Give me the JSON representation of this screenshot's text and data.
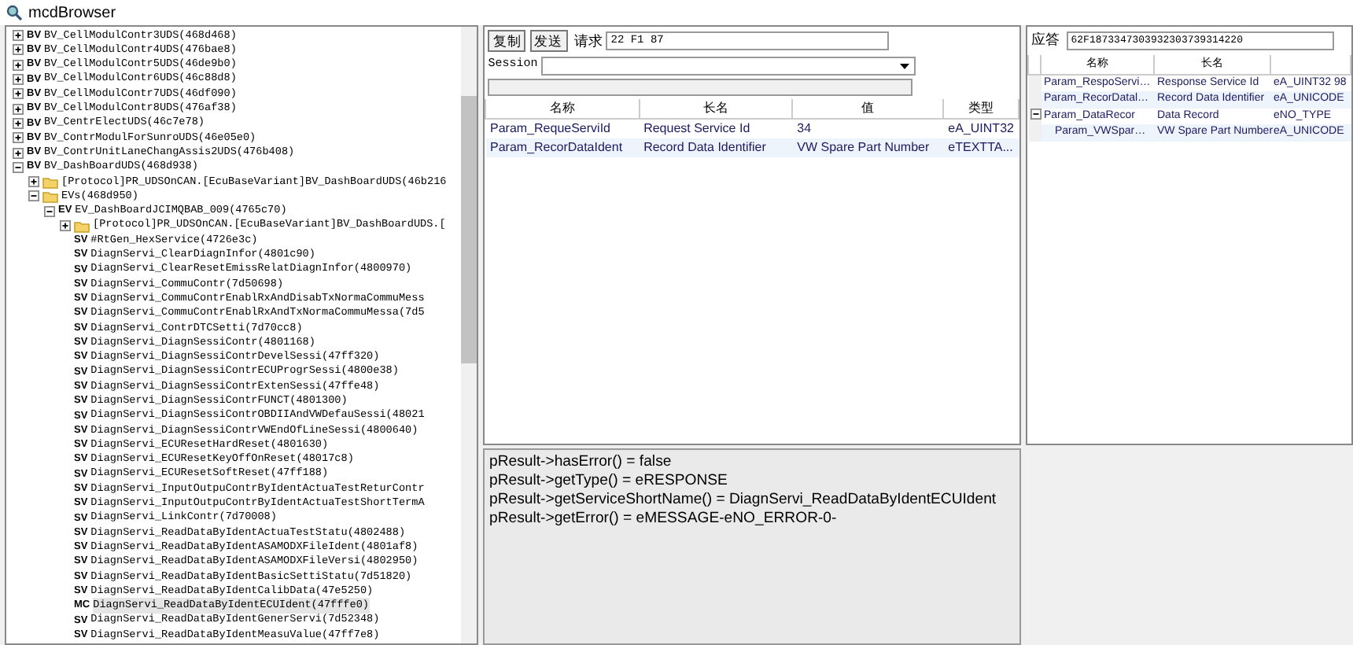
{
  "window": {
    "title": "mcdBrowser"
  },
  "tree": [
    {
      "badge": "BV",
      "label": "BV_CellModulContr3UDS(468d468)",
      "expanded": false,
      "selected": false
    },
    {
      "badge": "BV",
      "label": "BV_CellModulContr4UDS(476bae8)",
      "expanded": false,
      "selected": false
    },
    {
      "badge": "BV",
      "label": "BV_CellModulContr5UDS(46de9b0)",
      "expanded": false,
      "selected": false
    },
    {
      "badge": "BV",
      "label": "BV_CellModulContr6UDS(46c88d8)",
      "expanded": false,
      "selected": false
    },
    {
      "badge": "BV",
      "label": "BV_CellModulContr7UDS(46df090)",
      "expanded": false,
      "selected": false
    },
    {
      "badge": "BV",
      "label": "BV_CellModulContr8UDS(476af38)",
      "expanded": false,
      "selected": false
    },
    {
      "badge": "BV",
      "label": "BV_CentrElectUDS(46c7e78)",
      "expanded": false,
      "selected": false
    },
    {
      "badge": "BV",
      "label": "BV_ContrModulForSunroUDS(46e05e0)",
      "expanded": false,
      "selected": false
    },
    {
      "badge": "BV",
      "label": "BV_ContrUnitLaneChangAssis2UDS(476b408)",
      "expanded": false,
      "selected": false
    },
    {
      "badge": "BV",
      "label": "BV_DashBoardUDS(468d938)",
      "expanded": true,
      "selected": false,
      "children": [
        {
          "kind": "folder",
          "label": "[Protocol]PR_UDSOnCAN.[EcuBaseVariant]BV_DashBoardUDS(46b216",
          "expanded": false,
          "selected": false
        },
        {
          "kind": "folder",
          "label": "EVs(468d950)",
          "expanded": true,
          "selected": false,
          "children": [
            {
              "badge": "EV",
              "label": "EV_DashBoardJCIMQBAB_009(4765c70)",
              "expanded": true,
              "selected": false,
              "children": [
                {
                  "kind": "folder",
                  "label": "[Protocol]PR_UDSOnCAN.[EcuBaseVariant]BV_DashBoardUDS.[",
                  "expanded": false,
                  "selected": false
                },
                {
                  "badge": "SV",
                  "label": "#RtGen_HexService(4726e3c)",
                  "selected": false
                },
                {
                  "badge": "SV",
                  "label": "DiagnServi_ClearDiagnInfor(4801c90)",
                  "selected": false
                },
                {
                  "badge": "SV",
                  "label": "DiagnServi_ClearResetEmissRelatDiagnInfor(4800970)",
                  "selected": false
                },
                {
                  "badge": "SV",
                  "label": "DiagnServi_CommuContr(7d50698)",
                  "selected": false
                },
                {
                  "badge": "SV",
                  "label": "DiagnServi_CommuContrEnablRxAndDisabTxNormaCommuMess",
                  "selected": false
                },
                {
                  "badge": "SV",
                  "label": "DiagnServi_CommuContrEnablRxAndTxNormaCommuMessa(7d5",
                  "selected": false
                },
                {
                  "badge": "SV",
                  "label": "DiagnServi_ContrDTCSetti(7d70cc8)",
                  "selected": false
                },
                {
                  "badge": "SV",
                  "label": "DiagnServi_DiagnSessiContr(4801168)",
                  "selected": false
                },
                {
                  "badge": "SV",
                  "label": "DiagnServi_DiagnSessiContrDevelSessi(47ff320)",
                  "selected": false
                },
                {
                  "badge": "SV",
                  "label": "DiagnServi_DiagnSessiContrECUProgrSessi(4800e38)",
                  "selected": false
                },
                {
                  "badge": "SV",
                  "label": "DiagnServi_DiagnSessiContrExtenSessi(47ffe48)",
                  "selected": false
                },
                {
                  "badge": "SV",
                  "label": "DiagnServi_DiagnSessiContrFUNCT(4801300)",
                  "selected": false
                },
                {
                  "badge": "SV",
                  "label": "DiagnServi_DiagnSessiContrOBDIIAndVWDefauSessi(48021",
                  "selected": false
                },
                {
                  "badge": "SV",
                  "label": "DiagnServi_DiagnSessiContrVWEndOfLineSessi(4800640)",
                  "selected": false
                },
                {
                  "badge": "SV",
                  "label": "DiagnServi_ECUResetHardReset(4801630)",
                  "selected": false
                },
                {
                  "badge": "SV",
                  "label": "DiagnServi_ECUResetKeyOffOnReset(48017c8)",
                  "selected": false
                },
                {
                  "badge": "SV",
                  "label": "DiagnServi_ECUResetSoftReset(47ff188)",
                  "selected": false
                },
                {
                  "badge": "SV",
                  "label": "DiagnServi_InputOutpuContrByIdentActuaTestReturContr",
                  "selected": false
                },
                {
                  "badge": "SV",
                  "label": "DiagnServi_InputOutpuContrByIdentActuaTestShortTermA",
                  "selected": false
                },
                {
                  "badge": "SV",
                  "label": "DiagnServi_LinkContr(7d70008)",
                  "selected": false
                },
                {
                  "badge": "SV",
                  "label": "DiagnServi_ReadDataByIdentActuaTestStatu(4802488)",
                  "selected": false
                },
                {
                  "badge": "SV",
                  "label": "DiagnServi_ReadDataByIdentASAMODXFileIdent(4801af8)",
                  "selected": false
                },
                {
                  "badge": "SV",
                  "label": "DiagnServi_ReadDataByIdentASAMODXFileVersi(4802950)",
                  "selected": false
                },
                {
                  "badge": "SV",
                  "label": "DiagnServi_ReadDataByIdentBasicSettiStatu(7d51820)",
                  "selected": false
                },
                {
                  "badge": "SV",
                  "label": "DiagnServi_ReadDataByIdentCalibData(47e5250)",
                  "selected": false
                },
                {
                  "badge": "MC",
                  "label": "DiagnServi_ReadDataByIdentECUIdent(47fffe0)",
                  "selected": true
                },
                {
                  "badge": "SV",
                  "label": "DiagnServi_ReadDataByIdentGenerServi(7d52348)",
                  "selected": false
                },
                {
                  "badge": "SV",
                  "label": "DiagnServi_ReadDataByIdentMeasuValue(47ff7e8)",
                  "selected": false
                }
              ]
            }
          ]
        }
      ]
    }
  ],
  "request": {
    "buttons": [
      "复制",
      "发送"
    ],
    "label": "请求",
    "value": "22 F1 87",
    "session_label": "Session",
    "columns": [
      "名称",
      "长名",
      "值",
      "类型"
    ],
    "rows": [
      [
        "Param_RequeServiId",
        "Request Service Id",
        "34",
        "eA_UINT32"
      ],
      [
        "Param_RecorDataIdent",
        "Record Data Identifier",
        "VW Spare Part Number",
        "eTEXTTA..."
      ]
    ]
  },
  "log": [
    "pResult->hasError() = false",
    "pResult->getType() = eRESPONSE",
    "pResult->getServiceShortName() = DiagnServi_ReadDataByIdentECUIdent",
    "pResult->getError() = eMESSAGE-eNO_ERROR-0-"
  ],
  "response": {
    "label": "应答",
    "value": "62F1873347303932303739314220",
    "columns": [
      "名称",
      "长名"
    ],
    "rows": [
      {
        "cells": [
          "Param_RespoServi…",
          "Response Service Id",
          "eA_UINT32 98"
        ]
      },
      {
        "cells": [
          "Param_RecorDatal…",
          "Record Data Identifier",
          "eA_UNICODE"
        ]
      },
      {
        "cells": [
          "Param_DataRecor",
          "Data Record",
          "eNO_TYPE"
        ],
        "expanded": true,
        "children": [
          {
            "cells": [
              "Param_VWSpar…",
              "VW Spare Part Number",
              "eA_UNICODE"
            ]
          }
        ]
      }
    ]
  }
}
